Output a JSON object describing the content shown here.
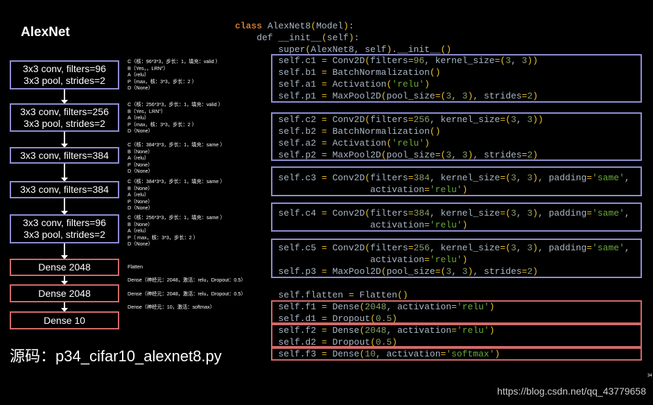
{
  "title": "AlexNet",
  "layers": [
    {
      "lines": [
        "3x3 conv, filters=96",
        "3x3 pool, strides=2"
      ],
      "color": "blue"
    },
    {
      "lines": [
        "3x3 conv, filters=256",
        "3x3 pool, strides=2"
      ],
      "color": "blue"
    },
    {
      "lines": [
        "3x3 conv, filters=384"
      ],
      "color": "blue"
    },
    {
      "lines": [
        "3x3 conv, filters=384"
      ],
      "color": "blue"
    },
    {
      "lines": [
        "3x3 conv, filters=96",
        "3x3 pool, strides=2"
      ],
      "color": "blue"
    },
    {
      "lines": [
        "Dense 2048"
      ],
      "color": "red"
    },
    {
      "lines": [
        "Dense 2048"
      ],
      "color": "red"
    },
    {
      "lines": [
        "Dense 10"
      ],
      "color": "red"
    }
  ],
  "annotations": [
    [
      "C（核：96*3*3，步长：1，填充：valid ）",
      "B（Yes，，LRN\"）",
      "A（relu）",
      "P（max，核：3*3，步长：2 ）",
      "D（None）"
    ],
    [
      "C（核：256*3*3，步长：1，填充：valid ）",
      "B（Yes，LRN\"）",
      "A（relu）",
      "P（max，核：3*3，步长：2 ）",
      "D（None）"
    ],
    [
      "C（核：384*3*3，步长：1，填充：same ）",
      "B（None）",
      "A（relu）",
      "P（None）",
      "D（None）"
    ],
    [
      "C（核：384*3*3，步长：1，填充：same ）",
      "B（None）",
      "A（relu）",
      "P（None）",
      "D（None）"
    ],
    [
      "C（核：256*3*3，步长：1，填充：same ）",
      "B（None）",
      "A（relu）",
      "P（ max，核：3*3，步长：2 ）",
      "D（None）"
    ],
    [
      "Flatten"
    ],
    [
      "Dense（神经元：2048，激活：relu，Dropout：0.5）"
    ],
    [
      "Dense（神经元：2048，激活：relu，Dropout：0.5）"
    ],
    [
      "Dense（神经元：10，激活：softmax）"
    ]
  ],
  "code": [
    "class AlexNet8(Model):",
    "    def __init__(self):",
    "        super(AlexNet8, self).__init__()",
    "        self.c1 = Conv2D(filters=96, kernel_size=(3, 3))",
    "        self.b1 = BatchNormalization()",
    "        self.a1 = Activation('relu')",
    "        self.p1 = MaxPool2D(pool_size=(3, 3), strides=2)",
    "",
    "        self.c2 = Conv2D(filters=256, kernel_size=(3, 3))",
    "        self.b2 = BatchNormalization()",
    "        self.a2 = Activation('relu')",
    "        self.p2 = MaxPool2D(pool_size=(3, 3), strides=2)",
    "",
    "        self.c3 = Conv2D(filters=384, kernel_size=(3, 3), padding='same',",
    "                         activation='relu')",
    "",
    "        self.c4 = Conv2D(filters=384, kernel_size=(3, 3), padding='same',",
    "                         activation='relu')",
    "",
    "        self.c5 = Conv2D(filters=256, kernel_size=(3, 3), padding='same',",
    "                         activation='relu')",
    "        self.p3 = MaxPool2D(pool_size=(3, 3), strides=2)",
    "",
    "        self.flatten = Flatten()",
    "        self.f1 = Dense(2048, activation='relu')",
    "        self.d1 = Dropout(0.5)",
    "        self.f2 = Dense(2048, activation='relu')",
    "        self.d2 = Dropout(0.5)",
    "        self.f3 = Dense(10, activation='softmax')"
  ],
  "footer": "源码：p34_cifar10_alexnet8.py",
  "watermark": "https://blog.csdn.net/qq_43779658",
  "page_number": "34",
  "colors": {
    "conv_box": "#8f8fd6",
    "dense_box": "#d46a6a"
  }
}
